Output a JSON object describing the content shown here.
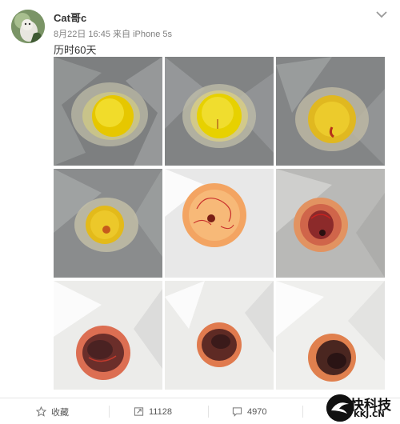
{
  "post": {
    "author": "Cat哥c",
    "date": "8月22日",
    "time": "16:45",
    "source_prefix": "来自",
    "device": "iPhone 5s",
    "text": "历时60天"
  },
  "images": [
    {
      "name": "egg-photo-1",
      "stage": "yolk-fresh"
    },
    {
      "name": "egg-photo-2",
      "stage": "yolk-fresh"
    },
    {
      "name": "egg-photo-3",
      "stage": "yolk-early-embryo"
    },
    {
      "name": "egg-photo-4",
      "stage": "yolk-early-embryo"
    },
    {
      "name": "egg-photo-5",
      "stage": "veins-developing"
    },
    {
      "name": "egg-photo-6",
      "stage": "embryo-red"
    },
    {
      "name": "egg-photo-7",
      "stage": "chick-formed"
    },
    {
      "name": "egg-photo-8",
      "stage": "chick-formed"
    },
    {
      "name": "egg-photo-9",
      "stage": "chick-formed"
    }
  ],
  "actions": {
    "favorite": "收藏",
    "repost_count": "11128",
    "comment_count": "4970"
  },
  "watermark": {
    "title": "快科技",
    "subtitle": "KKJ.CN"
  },
  "icons": {
    "favorite": "star-icon",
    "repost": "repost-icon",
    "comment": "comment-icon",
    "menu": "chevron-down-icon"
  }
}
